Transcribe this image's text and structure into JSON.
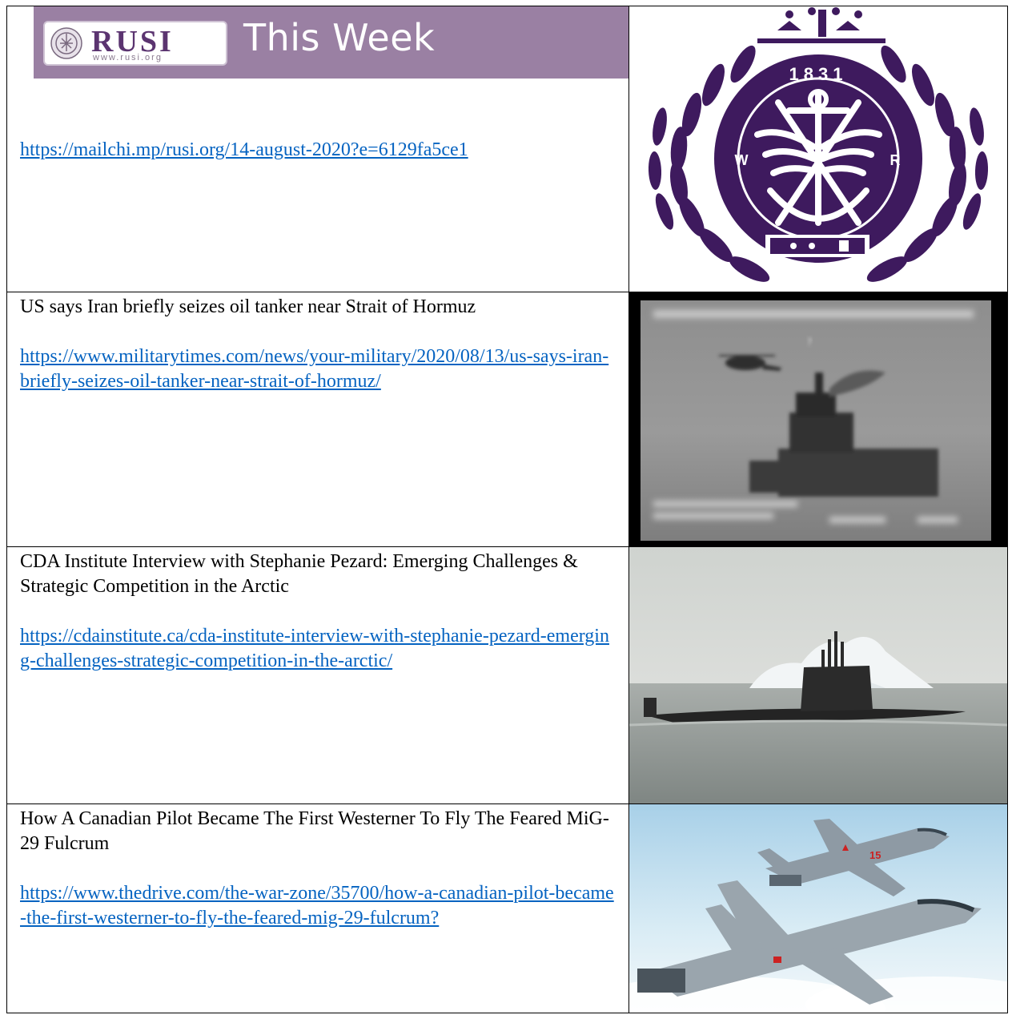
{
  "banner": {
    "logo_text": "RUSI",
    "logo_url": "www.rusi.org",
    "title": "This Week"
  },
  "rows": [
    {
      "headline": "",
      "link": "https://mailchi.mp/rusi.org/14-august-2020?e=6129fa5ce1",
      "image": "RUSI crest with anchor, wings, laurel wreath and crown",
      "crest_text": {
        "year": "1831",
        "left": "W",
        "right": "R"
      }
    },
    {
      "headline": "US says Iran briefly seizes oil tanker near Strait of Hormuz",
      "link": "https://www.militarytimes.com/news/your-military/2020/08/13/us-says-iran-briefly-seizes-oil-tanker-near-strait-of-hormuz/",
      "image": "Grayscale surveillance image of helicopter over tanker"
    },
    {
      "headline": "CDA Institute Interview with Stephanie Pezard: Emerging Challenges & Strategic Competition in the Arctic",
      "link": "https://cdainstitute.ca/cda-institute-interview-with-stephanie-pezard-emerging-challenges-strategic-competition-in-the-arctic/",
      "image": "Submarine surfaced near iceberg"
    },
    {
      "headline": "How A Canadian Pilot Became The First Westerner To Fly The Feared MiG-29 Fulcrum",
      "link": "https://www.thedrive.com/the-war-zone/35700/how-a-canadian-pilot-became-the-first-westerner-to-fly-the-feared-mig-29-fulcrum?",
      "image": "MiG-29 and CF-18 fighter jets in flight",
      "jet_marking": "15"
    }
  ],
  "colors": {
    "banner_bg": "#9a80a3",
    "link": "#0563c1",
    "crest_purple": "#3e1a5e"
  }
}
